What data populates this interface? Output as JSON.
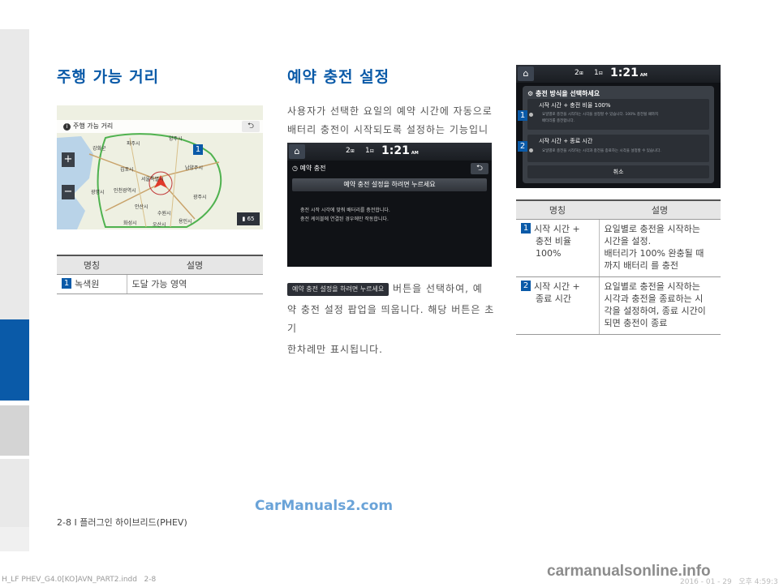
{
  "sidebar_colors": {
    "accent": "#0a5aa8"
  },
  "left": {
    "title": "주행 가능 거리",
    "screen": {
      "title": "주행 가능 거리",
      "places": [
        "파주시",
        "양주시",
        "남양주시",
        "강화군",
        "김포시",
        "서울특별시",
        "인천광역시",
        "광명시",
        "안산시",
        "수원시",
        "광주시",
        "용인시",
        "화성시",
        "오산시"
      ],
      "callout": "1",
      "zoom_in": "+",
      "zoom_out": "−",
      "scale_value": "65"
    },
    "table": {
      "headers": [
        "명칭",
        "설명"
      ],
      "rows": [
        {
          "num": "1",
          "name": "녹색원",
          "desc": "도달 가능 영역"
        }
      ]
    }
  },
  "middle": {
    "title": "예약 충전 설정",
    "intro": [
      "사용자가 선택한 요일의 예약 시간에 자동으로",
      "배터리 충전이 시작되도록 설정하는 기능입니다."
    ],
    "screen": {
      "status_num1": "2",
      "status_num2": "1",
      "time": "1:21",
      "ampm": "AM",
      "title": "예약 충전",
      "button": "예약 충전 설정을 하려면 누르세요",
      "notes": [
        "충전 시작 시각에 맞춰 배터리를 충전합니다.",
        "충전 케이블에 연결된 경우에만 작동합니다."
      ]
    },
    "button_label": "예약 충전 설정을 하려면 누르세요",
    "desc_lines": [
      "버튼을 선택하여, 예",
      "약 충전 설정 팝업을 띄웁니다. 해당 버튼은 초기",
      "한차례만 표시됩니다."
    ]
  },
  "right": {
    "screen": {
      "status_num1": "2",
      "status_num2": "1",
      "time": "1:21",
      "ampm": "AM",
      "popup_title": "충전 방식을 선택하세요",
      "opt1_label": "시작 시간 + 충전 비율 100%",
      "opt1_desc": [
        "요일별로 충전을 시작하는 시각을 설정할 수 있습니다. 100% 충전될 때까지",
        "배터리를 충전합니다."
      ],
      "opt2_label": "시작 시간 + 종료 시간",
      "opt2_desc": "요일별로 충전을 시작하는 시각과 충전을 종료하는 시각을 설정할 수 있습니다.",
      "cancel": "취소",
      "callout1": "1",
      "callout2": "2"
    },
    "table": {
      "headers": [
        "명칭",
        "설명"
      ],
      "rows": [
        {
          "num": "1",
          "name": [
            "시작 시간 +",
            "충전 비율",
            "100%"
          ],
          "desc": [
            "요일별로 충전을 시작하는",
            "시간을 설정.",
            "배터리가 100% 완충될 때",
            "까지 배터리 를 충전"
          ]
        },
        {
          "num": "2",
          "name": [
            "시작 시간 +",
            "종료 시간"
          ],
          "desc": [
            "요일별로 충전을 시작하는",
            "시각과 충전을 종료하는 시",
            "각을 설정하여, 종료 시간이",
            "되면 충전이 종료"
          ]
        }
      ]
    }
  },
  "footer": {
    "page": "2-8 I 플러그인 하이브리드(PHEV)",
    "watermark": "CarManuals2.com",
    "file": "H_LF PHEV_G4.0[KO]AVN_PART2.indd   2-8",
    "date": "2016 - 01 - 29   오후 4:59:3",
    "site": "carmanualsonline.info"
  }
}
